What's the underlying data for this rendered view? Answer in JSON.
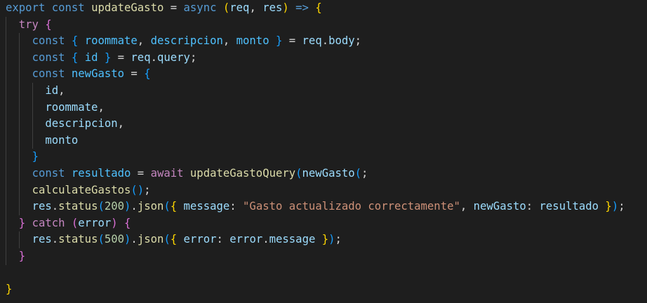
{
  "editor": {
    "lines": [
      [
        [
          "kw",
          "export"
        ],
        [
          "op",
          " "
        ],
        [
          "kw",
          "const"
        ],
        [
          "op",
          " "
        ],
        [
          "fn",
          "updateGasto"
        ],
        [
          "op",
          " = "
        ],
        [
          "kw",
          "async"
        ],
        [
          "op",
          " "
        ],
        [
          "b1",
          "("
        ],
        [
          "vr",
          "req"
        ],
        [
          "op",
          ", "
        ],
        [
          "vr",
          "res"
        ],
        [
          "b1",
          ")"
        ],
        [
          "op",
          " "
        ],
        [
          "kw",
          "=>"
        ],
        [
          "op",
          " "
        ],
        [
          "b1",
          "{"
        ]
      ],
      [
        [
          "op",
          "  "
        ],
        [
          "ctl",
          "try"
        ],
        [
          "op",
          " "
        ],
        [
          "b2",
          "{"
        ]
      ],
      [
        [
          "op",
          "    "
        ],
        [
          "kw",
          "const"
        ],
        [
          "op",
          " "
        ],
        [
          "b3",
          "{"
        ],
        [
          "op",
          " "
        ],
        [
          "cn",
          "roommate"
        ],
        [
          "op",
          ", "
        ],
        [
          "cn",
          "descripcion"
        ],
        [
          "op",
          ", "
        ],
        [
          "cn",
          "monto"
        ],
        [
          "op",
          " "
        ],
        [
          "b3",
          "}"
        ],
        [
          "op",
          " = "
        ],
        [
          "vr",
          "req"
        ],
        [
          "op",
          "."
        ],
        [
          "vr",
          "body"
        ],
        [
          "op",
          ";"
        ]
      ],
      [
        [
          "op",
          "    "
        ],
        [
          "kw",
          "const"
        ],
        [
          "op",
          " "
        ],
        [
          "b3",
          "{"
        ],
        [
          "op",
          " "
        ],
        [
          "cn",
          "id"
        ],
        [
          "op",
          " "
        ],
        [
          "b3",
          "}"
        ],
        [
          "op",
          " = "
        ],
        [
          "vr",
          "req"
        ],
        [
          "op",
          "."
        ],
        [
          "vr",
          "query"
        ],
        [
          "op",
          ";"
        ]
      ],
      [
        [
          "op",
          "    "
        ],
        [
          "kw",
          "const"
        ],
        [
          "op",
          " "
        ],
        [
          "cn",
          "newGasto"
        ],
        [
          "op",
          " = "
        ],
        [
          "b3",
          "{"
        ]
      ],
      [
        [
          "op",
          "      "
        ],
        [
          "vr",
          "id"
        ],
        [
          "op",
          ","
        ]
      ],
      [
        [
          "op",
          "      "
        ],
        [
          "vr",
          "roommate"
        ],
        [
          "op",
          ","
        ]
      ],
      [
        [
          "op",
          "      "
        ],
        [
          "vr",
          "descripcion"
        ],
        [
          "op",
          ","
        ]
      ],
      [
        [
          "op",
          "      "
        ],
        [
          "vr",
          "monto"
        ]
      ],
      [
        [
          "op",
          "    "
        ],
        [
          "b3",
          "}"
        ]
      ],
      [
        [
          "op",
          "    "
        ],
        [
          "kw",
          "const"
        ],
        [
          "op",
          " "
        ],
        [
          "cn",
          "resultado"
        ],
        [
          "op",
          " = "
        ],
        [
          "ctl",
          "await"
        ],
        [
          "op",
          " "
        ],
        [
          "fn",
          "updateGastoQuery"
        ],
        [
          "b3",
          "("
        ],
        [
          "vr",
          "newGasto"
        ],
        [
          "b3",
          "("
        ],
        [
          "op",
          ";"
        ]
      ],
      [
        [
          "op",
          "    "
        ],
        [
          "fn",
          "calculateGastos"
        ],
        [
          "b3",
          "()"
        ],
        [
          "op",
          ";"
        ]
      ],
      [
        [
          "op",
          "    "
        ],
        [
          "vr",
          "res"
        ],
        [
          "op",
          "."
        ],
        [
          "fn",
          "status"
        ],
        [
          "b3",
          "("
        ],
        [
          "nm",
          "200"
        ],
        [
          "b3",
          ")"
        ],
        [
          "op",
          "."
        ],
        [
          "fn",
          "json"
        ],
        [
          "b3",
          "("
        ],
        [
          "b1",
          "{"
        ],
        [
          "op",
          " "
        ],
        [
          "vr",
          "message"
        ],
        [
          "op",
          ": "
        ],
        [
          "st",
          "\"Gasto actualizado correctamente\""
        ],
        [
          "op",
          ", "
        ],
        [
          "vr",
          "newGasto"
        ],
        [
          "op",
          ": "
        ],
        [
          "vr",
          "resultado"
        ],
        [
          "op",
          " "
        ],
        [
          "b1",
          "}"
        ],
        [
          "b3",
          ")"
        ],
        [
          "op",
          ";"
        ]
      ],
      [
        [
          "op",
          "  "
        ],
        [
          "b2",
          "}"
        ],
        [
          "op",
          " "
        ],
        [
          "ctl",
          "catch"
        ],
        [
          "op",
          " "
        ],
        [
          "b2",
          "("
        ],
        [
          "vr",
          "error"
        ],
        [
          "b2",
          ")"
        ],
        [
          "op",
          " "
        ],
        [
          "b2",
          "{"
        ]
      ],
      [
        [
          "op",
          "    "
        ],
        [
          "vr",
          "res"
        ],
        [
          "op",
          "."
        ],
        [
          "fn",
          "status"
        ],
        [
          "b3",
          "("
        ],
        [
          "nm",
          "500"
        ],
        [
          "b3",
          ")"
        ],
        [
          "op",
          "."
        ],
        [
          "fn",
          "json"
        ],
        [
          "b3",
          "("
        ],
        [
          "b1",
          "{"
        ],
        [
          "op",
          " "
        ],
        [
          "vr",
          "error"
        ],
        [
          "op",
          ": "
        ],
        [
          "vr",
          "error"
        ],
        [
          "op",
          "."
        ],
        [
          "vr",
          "message"
        ],
        [
          "op",
          " "
        ],
        [
          "b1",
          "}"
        ],
        [
          "b3",
          ")"
        ],
        [
          "op",
          ";"
        ]
      ],
      [
        [
          "op",
          "  "
        ],
        [
          "b2",
          "}"
        ]
      ],
      [],
      [
        [
          "b1",
          "}"
        ]
      ]
    ]
  }
}
